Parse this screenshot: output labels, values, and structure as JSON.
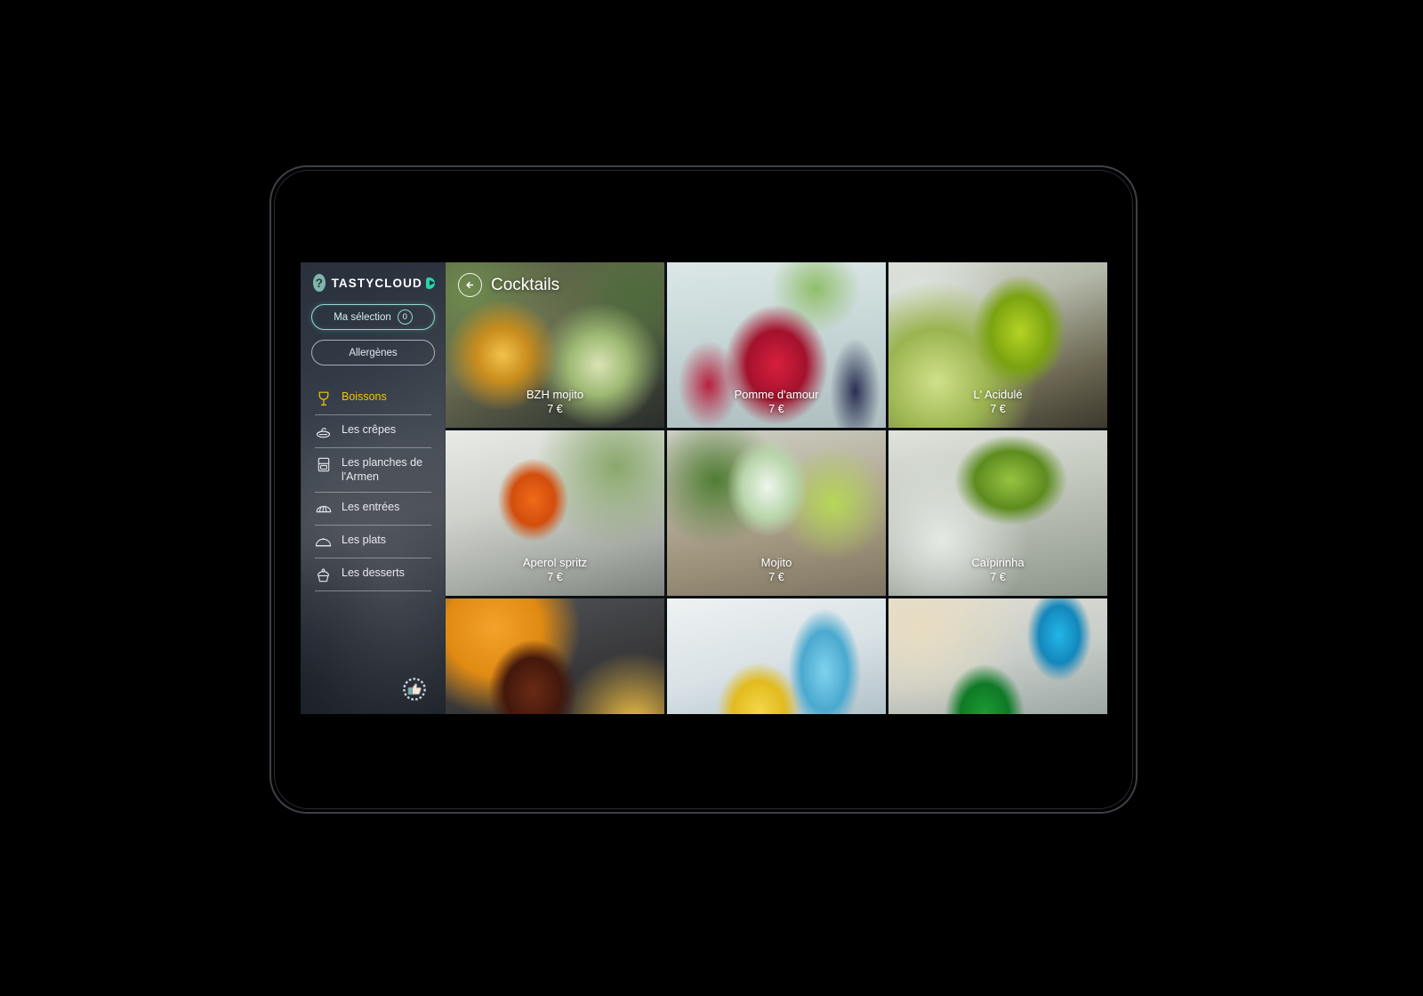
{
  "brand": {
    "help_icon": "question-mark-icon",
    "name": "TASTYCLOUD",
    "mark_icon": "cloud-play-icon",
    "accent_color": "#27d3ae"
  },
  "sidebar": {
    "selection": {
      "label": "Ma sélection",
      "count": "0"
    },
    "allergens": {
      "label": "Allergènes"
    },
    "nav": [
      {
        "label": "Boissons",
        "icon": "wine-glass-icon",
        "active": true
      },
      {
        "label": "Les crêpes",
        "icon": "crepe-icon",
        "active": false
      },
      {
        "label": "Les planches de l'Armen",
        "icon": "board-icon",
        "active": false
      },
      {
        "label": "Les entrées",
        "icon": "bread-icon",
        "active": false
      },
      {
        "label": "Les plats",
        "icon": "cloche-icon",
        "active": false
      },
      {
        "label": "Les desserts",
        "icon": "cupcake-icon",
        "active": false
      }
    ],
    "footer_icon": "thumbs-up-badge-icon",
    "active_color": "#f3c40a"
  },
  "header": {
    "back_icon": "back-arrow-icon",
    "title": "Cocktails"
  },
  "grid": {
    "items": [
      {
        "name": "BZH mojito",
        "price": "7 €",
        "image": "img-bzh",
        "has_caption": true
      },
      {
        "name": "Pomme d'amour",
        "price": "7 €",
        "image": "img-pomme",
        "has_caption": true
      },
      {
        "name": "L' Acidulé",
        "price": "7 €",
        "image": "img-acidule",
        "has_caption": true
      },
      {
        "name": "Aperol spritz",
        "price": "7 €",
        "image": "img-aperol",
        "has_caption": true
      },
      {
        "name": "Mojito",
        "price": "7 €",
        "image": "img-mojito",
        "has_caption": true
      },
      {
        "name": "Caïpirinha",
        "price": "7 €",
        "image": "img-caipi",
        "has_caption": true
      },
      {
        "name": "",
        "price": "",
        "image": "img-cuba",
        "has_caption": false
      },
      {
        "name": "",
        "price": "",
        "image": "img-yellow",
        "has_caption": false
      },
      {
        "name": "",
        "price": "",
        "image": "img-green",
        "has_caption": false
      }
    ]
  }
}
